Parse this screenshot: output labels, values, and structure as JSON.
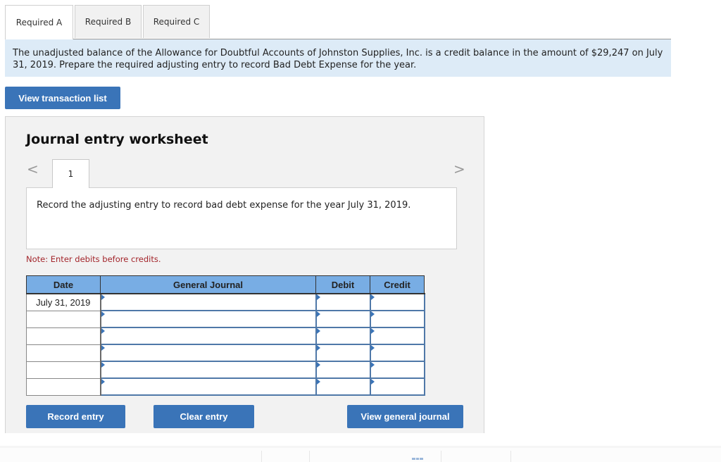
{
  "tabs": [
    {
      "label": "Required A",
      "active": true
    },
    {
      "label": "Required B",
      "active": false
    },
    {
      "label": "Required C",
      "active": false
    }
  ],
  "prompt": {
    "text": "The unadjusted balance of the Allowance for Doubtful Accounts of Johnston Supplies, Inc. is a credit balance in the amount of $29,247 on July 31, 2019. Prepare the required adjusting entry to record Bad Debt Expense for the year."
  },
  "buttons": {
    "view_transaction_list": "View transaction list",
    "record_entry": "Record entry",
    "clear_entry": "Clear entry",
    "view_general_journal": "View general journal"
  },
  "worksheet": {
    "title": "Journal entry worksheet",
    "nav_prev": "<",
    "nav_next": ">",
    "current_page": "1",
    "instruction": "Record the adjusting entry to record bad debt expense for the year July 31, 2019.",
    "note": "Note: Enter debits before credits."
  },
  "journal": {
    "headers": [
      "Date",
      "General Journal",
      "Debit",
      "Credit"
    ],
    "rows": [
      {
        "date": "July 31, 2019",
        "account": "",
        "debit": "",
        "credit": ""
      },
      {
        "date": "",
        "account": "",
        "debit": "",
        "credit": ""
      },
      {
        "date": "",
        "account": "",
        "debit": "",
        "credit": ""
      },
      {
        "date": "",
        "account": "",
        "debit": "",
        "credit": ""
      },
      {
        "date": "",
        "account": "",
        "debit": "",
        "credit": ""
      },
      {
        "date": "",
        "account": "",
        "debit": "",
        "credit": ""
      }
    ]
  },
  "colors": {
    "button_blue": "#3a74b8",
    "header_blue": "#78ade4",
    "prompt_bg": "#ddebf7",
    "note_red": "#a3252b"
  }
}
